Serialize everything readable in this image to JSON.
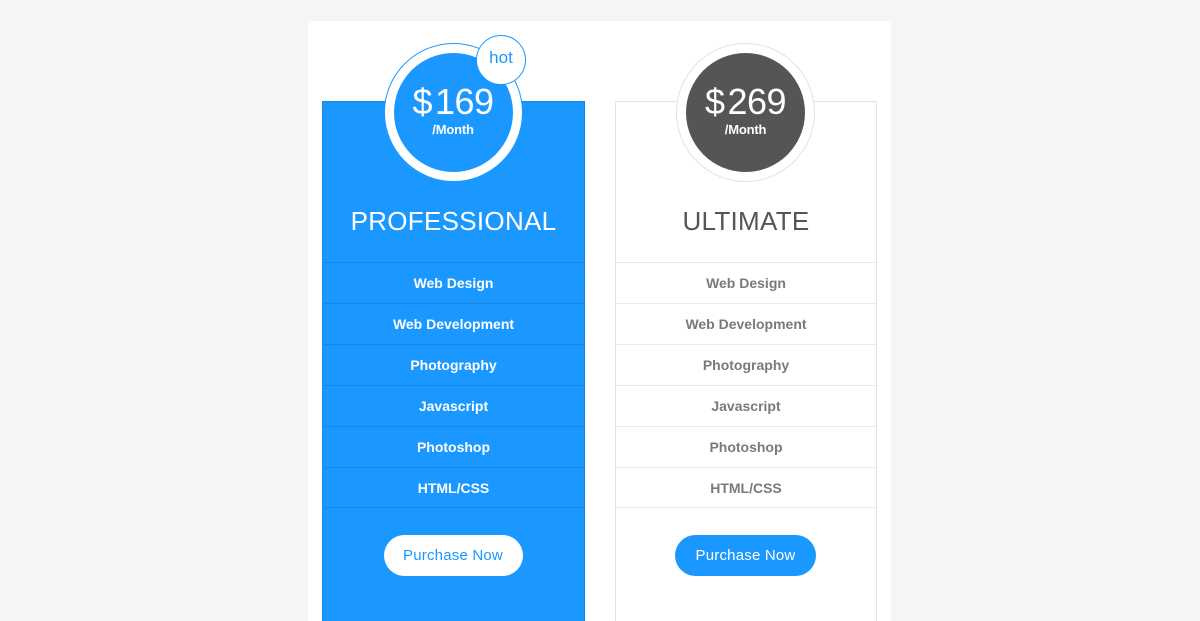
{
  "plans": [
    {
      "name": "PROFESSIONAL",
      "currency": "$",
      "price": "169",
      "period": "/Month",
      "badge": "hot",
      "featured": true,
      "features": [
        "Web Design",
        "Web Development",
        "Photography",
        "Javascript",
        "Photoshop",
        "HTML/CSS"
      ],
      "button_label": "Purchase Now"
    },
    {
      "name": "ULTIMATE",
      "currency": "$",
      "price": "269",
      "period": "/Month",
      "featured": false,
      "features": [
        "Web Design",
        "Web Development",
        "Photography",
        "Javascript",
        "Photoshop",
        "HTML/CSS"
      ],
      "button_label": "Purchase Now"
    }
  ],
  "colors": {
    "accent": "#1a98ff",
    "dark": "#555555",
    "background": "#f5f5f5"
  }
}
